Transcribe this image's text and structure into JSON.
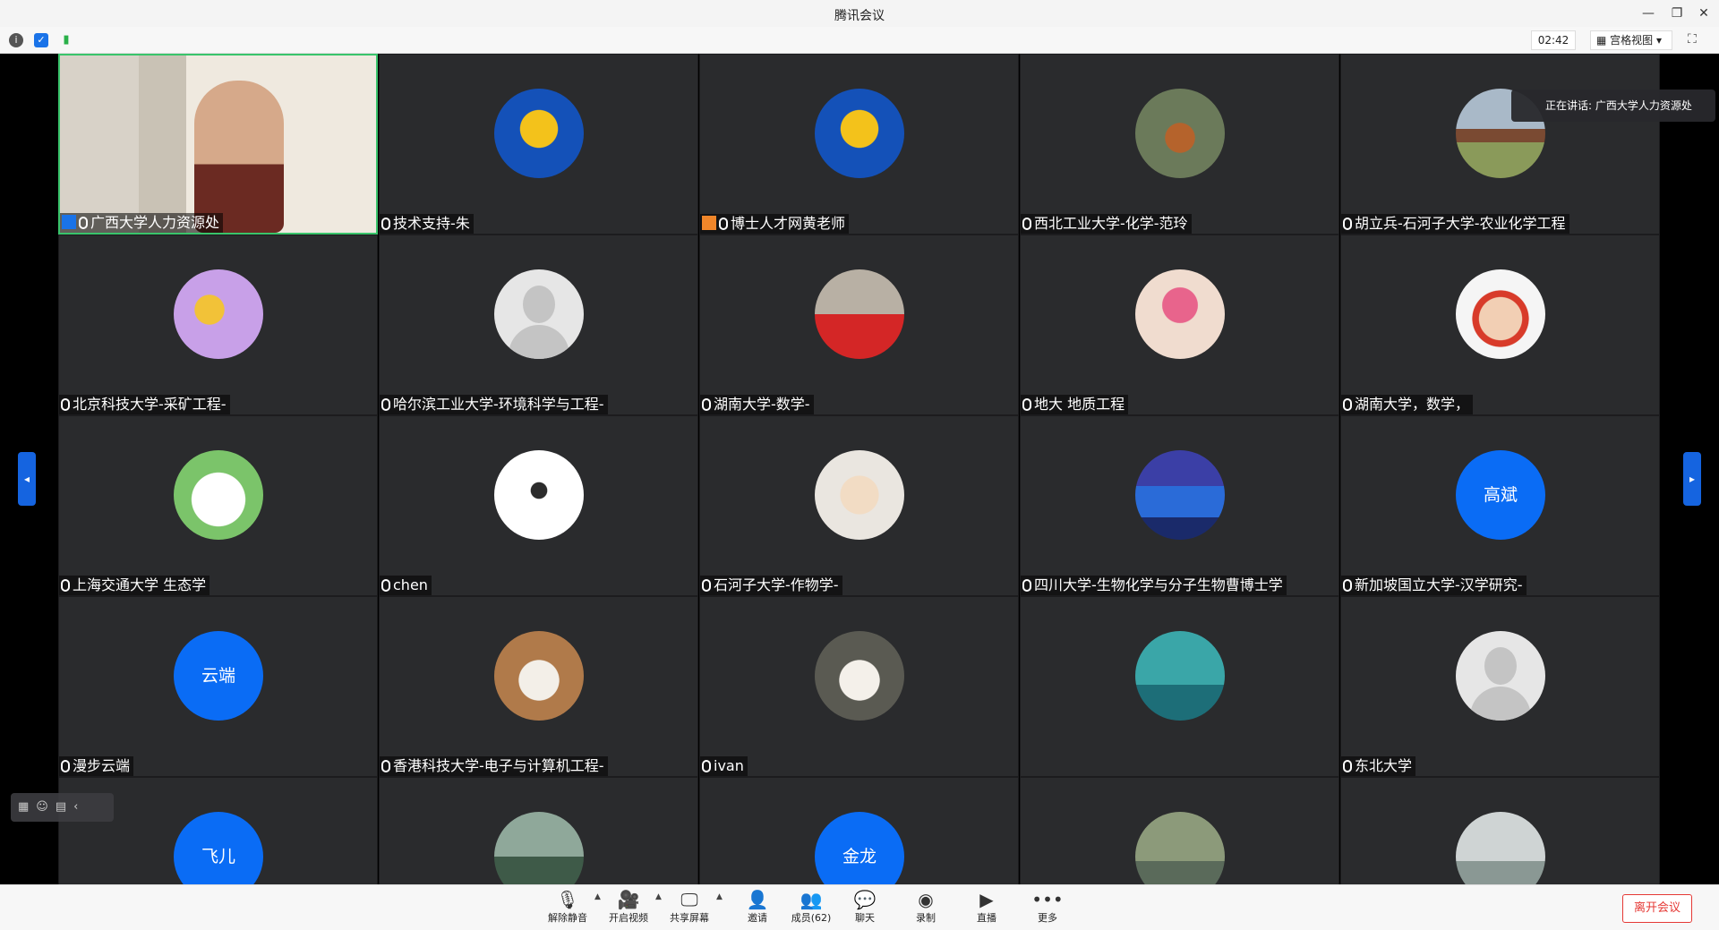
{
  "window": {
    "title": "腾讯会议"
  },
  "toolbar": {
    "timer": "02:42",
    "view_label": "宫格视图"
  },
  "speaking": {
    "text": "正在讲话: 广西大学人力资源处"
  },
  "tiles": [
    {
      "name": "广西大学人力资源处",
      "avatar": "video",
      "host": true
    },
    {
      "name": "技术支持-朱",
      "avatar": "logo"
    },
    {
      "name": "博士人才网黄老师",
      "avatar": "logo",
      "host": true
    },
    {
      "name": "西北工业大学-化学-范玲",
      "avatar": "squirrel"
    },
    {
      "name": "胡立兵-石河子大学-农业化学工程",
      "avatar": "landscape"
    },
    {
      "name": "北京科技大学-采矿工程-",
      "avatar": "anime"
    },
    {
      "name": "哈尔滨工业大学-环境科学与工程-",
      "avatar": "grey"
    },
    {
      "name": "湖南大学-数学-",
      "avatar": "girl-red"
    },
    {
      "name": "地大 地质工程",
      "avatar": "baby"
    },
    {
      "name": "湖南大学，数学，",
      "avatar": "cartoon"
    },
    {
      "name": "上海交通大学 生态学",
      "avatar": "panda"
    },
    {
      "name": "chen",
      "avatar": "pandalogo"
    },
    {
      "name": "石河子大学-作物学-",
      "avatar": "girl-hat"
    },
    {
      "name": "四川大学-生物化学与分子生物曹博士学",
      "avatar": "castle"
    },
    {
      "name": "新加坡国立大学-汉学研究-",
      "avatar": "text",
      "avatar_text": "高斌"
    },
    {
      "name": "漫步云端",
      "avatar": "text",
      "avatar_text": "云端"
    },
    {
      "name": "香港科技大学-电子与计算机工程-",
      "avatar": "cat"
    },
    {
      "name": "ivan",
      "avatar": "tea"
    },
    {
      "name": "",
      "avatar": "lake"
    },
    {
      "name": "东北大学",
      "avatar": "grey"
    },
    {
      "name": "",
      "avatar": "text",
      "avatar_text": "飞儿"
    },
    {
      "name": "",
      "avatar": "forest"
    },
    {
      "name": "",
      "avatar": "text",
      "avatar_text": "金龙"
    },
    {
      "name": "",
      "avatar": "man"
    },
    {
      "name": "",
      "avatar": "sea"
    }
  ],
  "bottom": {
    "unmute": "解除静音",
    "video": "开启视频",
    "share": "共享屏幕",
    "invite": "邀请",
    "members": "成员(62)",
    "chat": "聊天",
    "record": "录制",
    "live": "直播",
    "more": "更多",
    "leave": "离开会议"
  }
}
